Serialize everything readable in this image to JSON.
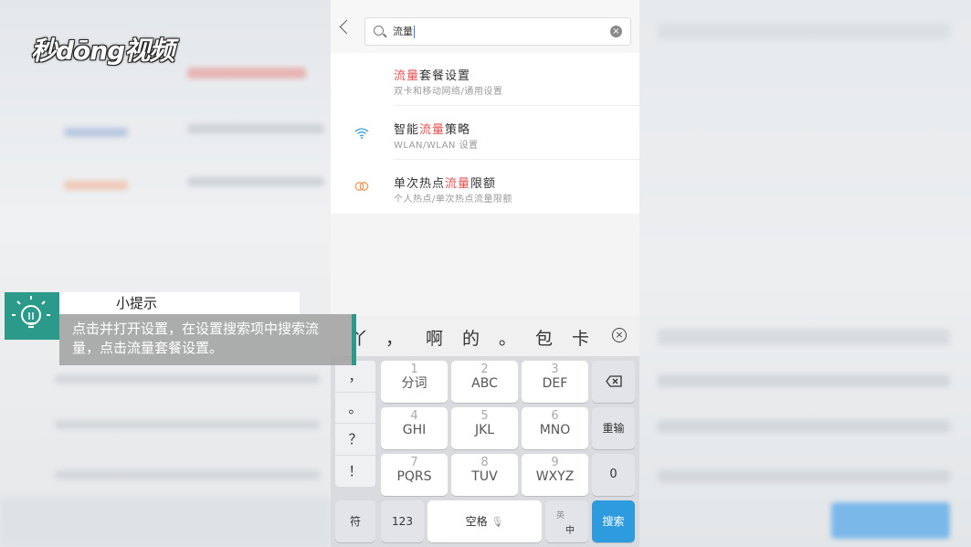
{
  "logo": {
    "text": "秒dōng视频"
  },
  "search": {
    "query": "流量",
    "clear_icon": "clear-icon"
  },
  "results": [
    {
      "pre": "",
      "hl": "流量",
      "post": "套餐设置",
      "sub": "双卡和移动网络/通用设置",
      "icon": "none"
    },
    {
      "pre": "智能",
      "hl": "流量",
      "post": "策略",
      "sub": "WLAN/WLAN 设置",
      "icon": "wifi-icon"
    },
    {
      "pre": "单次热点",
      "hl": "流量",
      "post": "限额",
      "sub": "个人热点/单次热点流量限额",
      "icon": "hotspot-icon"
    }
  ],
  "candidates": [
    "丫",
    "，",
    "啊",
    "的",
    "。",
    "包",
    "卡"
  ],
  "keyboard": {
    "side": [
      "，",
      "。",
      "？",
      "！"
    ],
    "keys": [
      {
        "n": "1",
        "l": "分词"
      },
      {
        "n": "2",
        "l": "ABC"
      },
      {
        "n": "3",
        "l": "DEF"
      },
      {
        "n": "4",
        "l": "GHI"
      },
      {
        "n": "5",
        "l": "JKL"
      },
      {
        "n": "6",
        "l": "MNO"
      },
      {
        "n": "7",
        "l": "PQRS"
      },
      {
        "n": "8",
        "l": "TUV"
      },
      {
        "n": "9",
        "l": "WXYZ"
      }
    ],
    "retype": "重输",
    "zero": "0",
    "symbol": "符",
    "num": "123",
    "space": "空格",
    "lang_top": "英",
    "lang_bottom": "中",
    "search": "搜索"
  },
  "tip": {
    "title": "小提示",
    "body": "点击并打开设置，在设置搜索项中搜索流量，点击流量套餐设置。"
  },
  "colors": {
    "highlight": "#e45151",
    "accent": "#2e9bde",
    "tip": "#2c9a8a"
  }
}
